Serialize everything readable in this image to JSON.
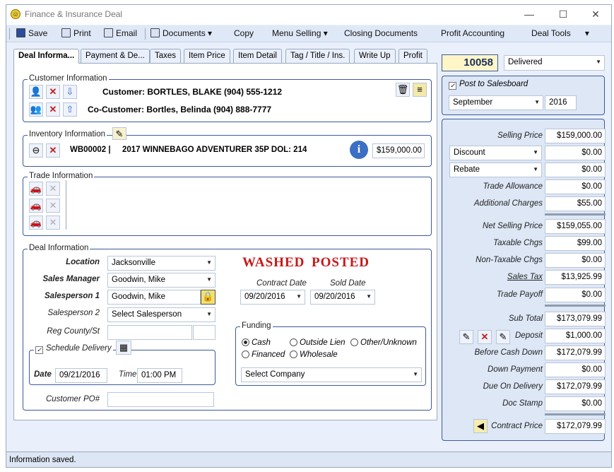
{
  "window": {
    "title": "Finance & Insurance Deal",
    "minimize": "—",
    "maximize": "☐",
    "close": "✕"
  },
  "toolbar": {
    "save": "Save",
    "print": "Print",
    "email": "Email",
    "documents": "Documents",
    "copy": "Copy",
    "menu_selling": "Menu Selling",
    "closing_documents": "Closing Documents",
    "profit_accounting": "Profit Accounting",
    "deal_tools": "Deal Tools",
    "dropdown_arrow": "▾"
  },
  "tabs": [
    "Deal Informa...",
    "Payment & De...",
    "Taxes",
    "Item Price",
    "Item Detail",
    "Tag / Title / Ins.",
    "Write Up",
    "Profit"
  ],
  "customer": {
    "section_label": "Customer Information",
    "customer": "Customer: BORTLES, BLAKE  (904) 555-1212",
    "co_customer": "Co-Customer: Bortles, Belinda  (904) 888-7777"
  },
  "inventory": {
    "section_label": "Inventory Information",
    "stock": "WB00002 |",
    "description": "2017 WINNEBAGO ADVENTURER 35P DOL: 214",
    "price": "$159,000.00"
  },
  "trade": {
    "section_label": "Trade Information"
  },
  "deal": {
    "section_label": "Deal Information",
    "location_label": "Location",
    "location": "Jacksonville",
    "sales_manager_label": "Sales Manager",
    "sales_manager": "Goodwin, Mike",
    "salesperson1_label": "Salesperson 1",
    "salesperson1": "Goodwin, Mike",
    "salesperson2_label": "Salesperson 2",
    "salesperson2": "Select Salesperson",
    "reg_county_label": "Reg County/St",
    "schedule_delivery_label": "Schedule Delivery",
    "date_label": "Date",
    "date": "09/21/2016",
    "time_label": "Time",
    "time": "01:00 PM",
    "customer_po_label": "Customer PO#",
    "stamp_washed": "WASHED",
    "stamp_posted": "POSTED",
    "contract_date_label": "Contract Date",
    "contract_date": "09/20/2016",
    "sold_date_label": "Sold Date",
    "sold_date": "09/20/2016",
    "funding_label": "Funding",
    "funding_options": {
      "cash": "Cash",
      "outside_lien": "Outside Lien",
      "other_unknown": "Other/Unknown",
      "financed": "Financed",
      "wholesale": "Wholesale"
    },
    "company": "Select Company"
  },
  "summary": {
    "deal_number": "10058",
    "status": "Delivered",
    "post_to_salesboard": "Post to Salesboard",
    "month": "September",
    "year": "2016",
    "discount_label": "Discount",
    "rebate_label": "Rebate",
    "rows": {
      "selling_price": {
        "label": "Selling Price",
        "value": "$159,000.00"
      },
      "discount": {
        "value": "$0.00"
      },
      "rebate": {
        "value": "$0.00"
      },
      "trade_allowance": {
        "label": "Trade Allowance",
        "value": "$0.00"
      },
      "additional_charges": {
        "label": "Additional Charges",
        "value": "$55.00"
      },
      "net_selling_price": {
        "label": "Net Selling Price",
        "value": "$159,055.00"
      },
      "taxable_chgs": {
        "label": "Taxable Chgs",
        "value": "$99.00"
      },
      "non_taxable_chgs": {
        "label": "Non-Taxable Chgs",
        "value": "$0.00"
      },
      "sales_tax": {
        "label": "Sales Tax",
        "value": "$13,925.99"
      },
      "trade_payoff": {
        "label": "Trade Payoff",
        "value": "$0.00"
      },
      "sub_total": {
        "label": "Sub Total",
        "value": "$173,079.99"
      },
      "deposit": {
        "label": "Deposit",
        "value": "$1,000.00"
      },
      "before_cash_down": {
        "label": "Before Cash Down",
        "value": "$172,079.99"
      },
      "down_payment": {
        "label": "Down Payment",
        "value": "$0.00"
      },
      "due_on_delivery": {
        "label": "Due On Delivery",
        "value": "$172,079.99"
      },
      "doc_stamp": {
        "label": "Doc Stamp",
        "value": "$0.00"
      },
      "contract_price": {
        "label": "Contract Price",
        "value": "$172,079.99"
      }
    }
  },
  "status_bar": "Information saved."
}
